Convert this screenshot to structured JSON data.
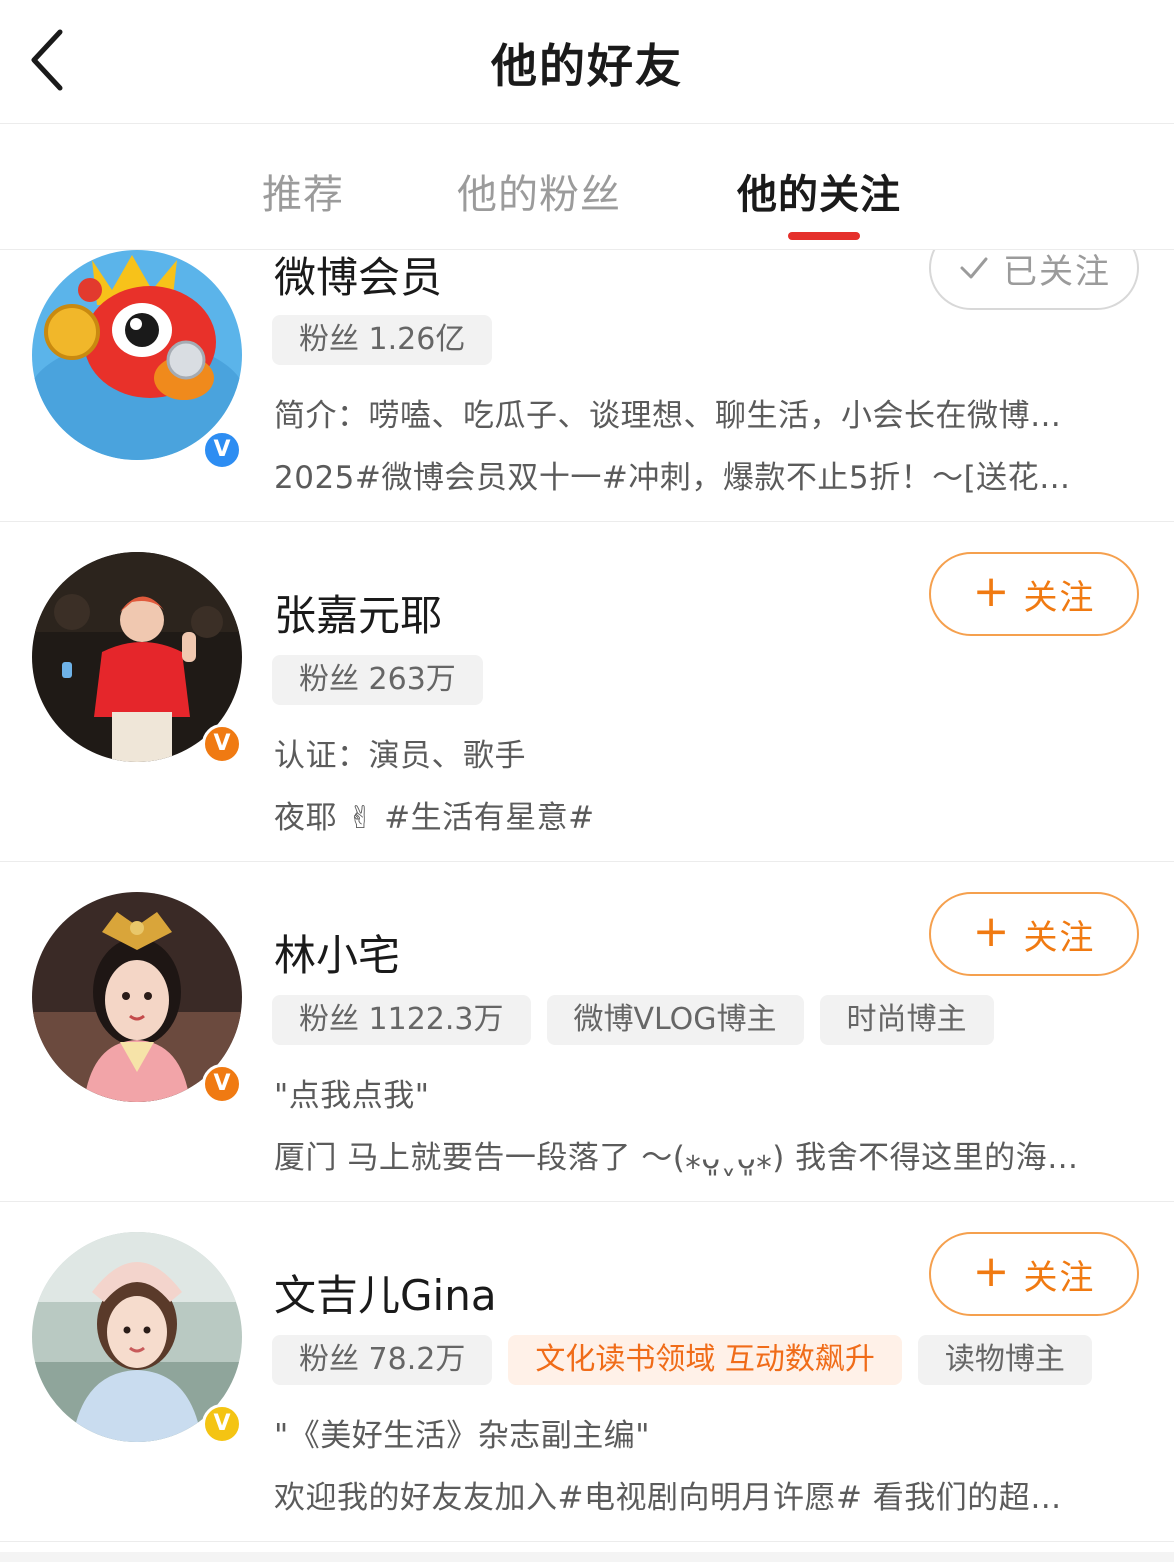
{
  "header": {
    "back_label": "返回",
    "title": "他的好友"
  },
  "tabs": [
    {
      "label": "推荐"
    },
    {
      "label": "他的粉丝"
    },
    {
      "label": "他的关注"
    }
  ],
  "active_tab": 2,
  "colors": {
    "accent": "#f07a12",
    "tab_indicator": "#e5302b",
    "badge_blue": "#2d8df2",
    "badge_orange": "#f07a12",
    "badge_gold": "#f4c413"
  },
  "users": [
    {
      "name": "微博会员",
      "badge": "blue",
      "avatar_icon": "weibo-vip-mascot-icon",
      "tags": [
        "粉丝 1.26亿"
      ],
      "bio": "简介：唠嗑、吃瓜子、谈理想、聊生活，小会长在微博…",
      "latest": "2025#微博会员双十一#冲刺，爆款不止5折！～[送花…",
      "follow_label": "已关注",
      "followed": true
    },
    {
      "name": "张嘉元耶",
      "badge": "orange",
      "avatar_icon": "user-photo-avatar",
      "tags": [
        "粉丝 263万"
      ],
      "bio": "认证：演员、歌手",
      "latest": "夜耶 ✌ #生活有星意#",
      "follow_label": "关注",
      "followed": false
    },
    {
      "name": "林小宅",
      "badge": "orange",
      "avatar_icon": "user-photo-avatar",
      "tags": [
        "粉丝 1122.3万",
        "微博VLOG博主",
        "时尚博主"
      ],
      "bio": "\"点我点我\"",
      "latest": "厦门 马上就要告一段落了 ～(⁎ᴗ͈ˬᴗ͈⁎) 我舍不得这里的海…",
      "follow_label": "关注",
      "followed": false
    },
    {
      "name": "文吉儿Gina",
      "badge": "gold",
      "avatar_icon": "user-photo-avatar",
      "tags": [
        "粉丝 78.2万",
        "文化读书领域 互动数飙升",
        "读物博主"
      ],
      "bio": "\"《美好生活》杂志副主编\"",
      "latest": "欢迎我的好友友加入#电视剧向明月许愿# 看我们的超…",
      "follow_label": "关注",
      "followed": false
    }
  ]
}
